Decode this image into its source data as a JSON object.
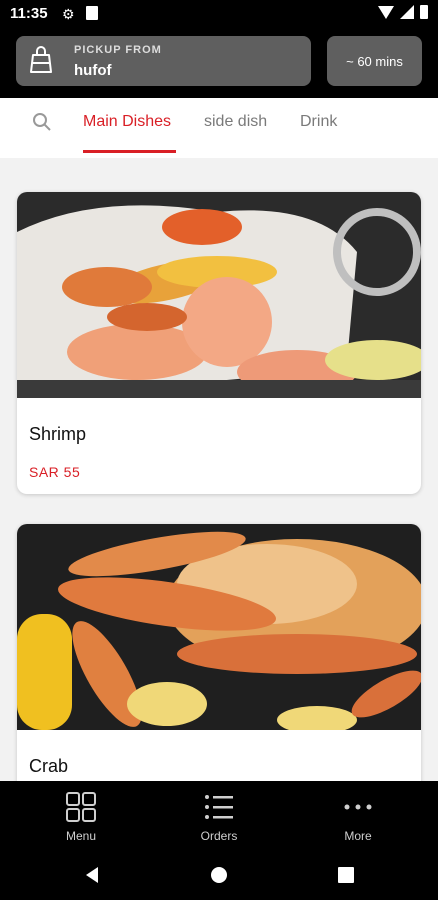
{
  "status_bar": {
    "time": "11:35",
    "icons": [
      "settings-icon",
      "sim-card-icon",
      "wifi-icon",
      "signal-icon",
      "battery-icon"
    ]
  },
  "header": {
    "pickup_label": "PICKUP FROM",
    "pickup_value": "hufof",
    "eta": "~ 60 mins"
  },
  "tabs": [
    {
      "label": "Main Dishes",
      "active": true
    },
    {
      "label": "side dish",
      "active": false
    },
    {
      "label": "Drink",
      "active": false
    }
  ],
  "dishes": [
    {
      "name": "Shrimp",
      "price": "SAR 55"
    },
    {
      "name": "Crab"
    }
  ],
  "bottom_nav": [
    {
      "label": "Menu",
      "icon": "grid-icon"
    },
    {
      "label": "Orders",
      "icon": "list-icon"
    },
    {
      "label": "More",
      "icon": "more-dots-icon"
    }
  ],
  "colors": {
    "accent": "#d91f26",
    "header_bg": "#000000",
    "pill_bg": "#5f5f5f",
    "content_bg": "#f2f2f2"
  }
}
